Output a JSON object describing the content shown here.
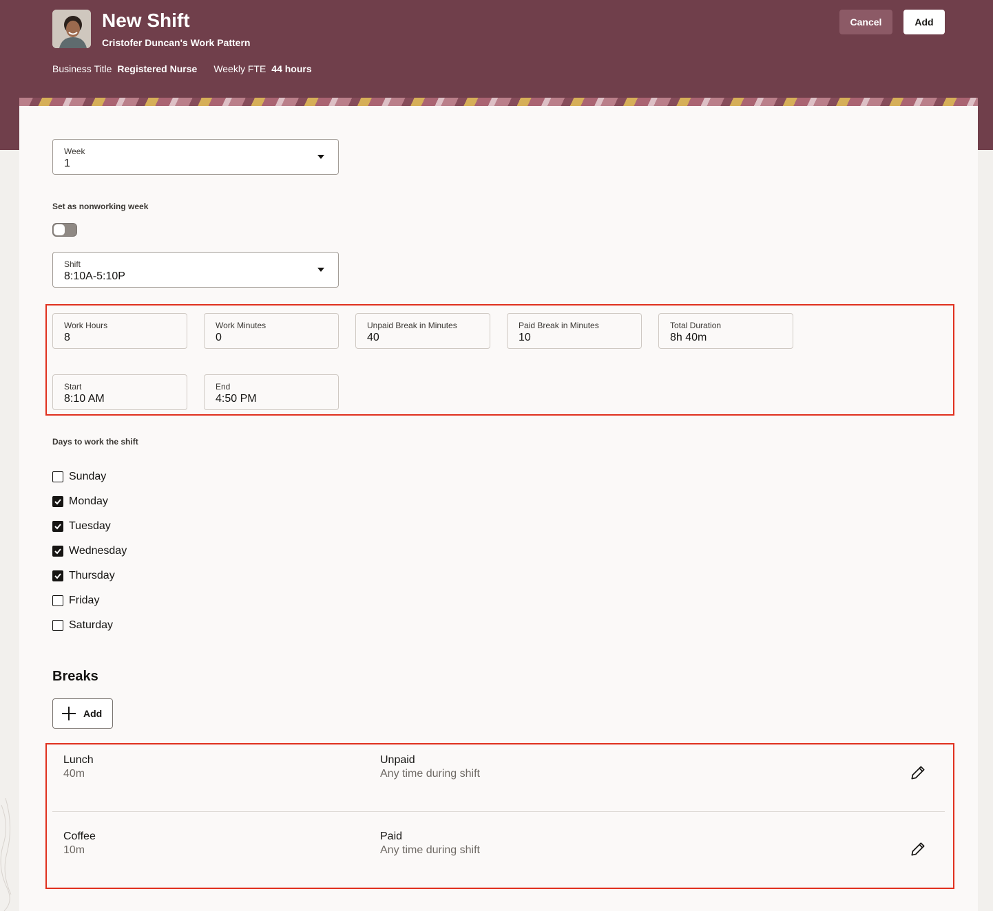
{
  "header": {
    "title": "New Shift",
    "subtitle": "Cristofer Duncan's Work Pattern",
    "business_title_label": "Business Title",
    "business_title_value": "Registered Nurse",
    "weekly_fte_label": "Weekly FTE",
    "weekly_fte_value": "44 hours",
    "cancel_label": "Cancel",
    "add_label": "Add"
  },
  "colors": {
    "header_bg": "#703f4b",
    "highlight": "#e0301e"
  },
  "form": {
    "week": {
      "label": "Week",
      "value": "1"
    },
    "nonworking_label": "Set as nonworking week",
    "nonworking_on": false,
    "shift": {
      "label": "Shift",
      "value": "8:10A-5:10P"
    },
    "work_hours": {
      "label": "Work Hours",
      "value": "8"
    },
    "work_minutes": {
      "label": "Work Minutes",
      "value": "0"
    },
    "unpaid_break": {
      "label": "Unpaid Break in Minutes",
      "value": "40"
    },
    "paid_break": {
      "label": "Paid Break in Minutes",
      "value": "10"
    },
    "total_duration": {
      "label": "Total Duration",
      "value": "8h 40m"
    },
    "start": {
      "label": "Start",
      "value": "8:10 AM"
    },
    "end": {
      "label": "End",
      "value": "4:50 PM"
    }
  },
  "days": {
    "label": "Days to work the shift",
    "items": [
      {
        "label": "Sunday",
        "checked": false
      },
      {
        "label": "Monday",
        "checked": true
      },
      {
        "label": "Tuesday",
        "checked": true
      },
      {
        "label": "Wednesday",
        "checked": true
      },
      {
        "label": "Thursday",
        "checked": true
      },
      {
        "label": "Friday",
        "checked": false
      },
      {
        "label": "Saturday",
        "checked": false
      }
    ]
  },
  "breaks": {
    "title": "Breaks",
    "add_label": "Add",
    "rows": [
      {
        "name": "Lunch",
        "duration": "40m",
        "type": "Unpaid",
        "when": "Any time during shift"
      },
      {
        "name": "Coffee",
        "duration": "10m",
        "type": "Paid",
        "when": "Any time during shift"
      }
    ]
  }
}
